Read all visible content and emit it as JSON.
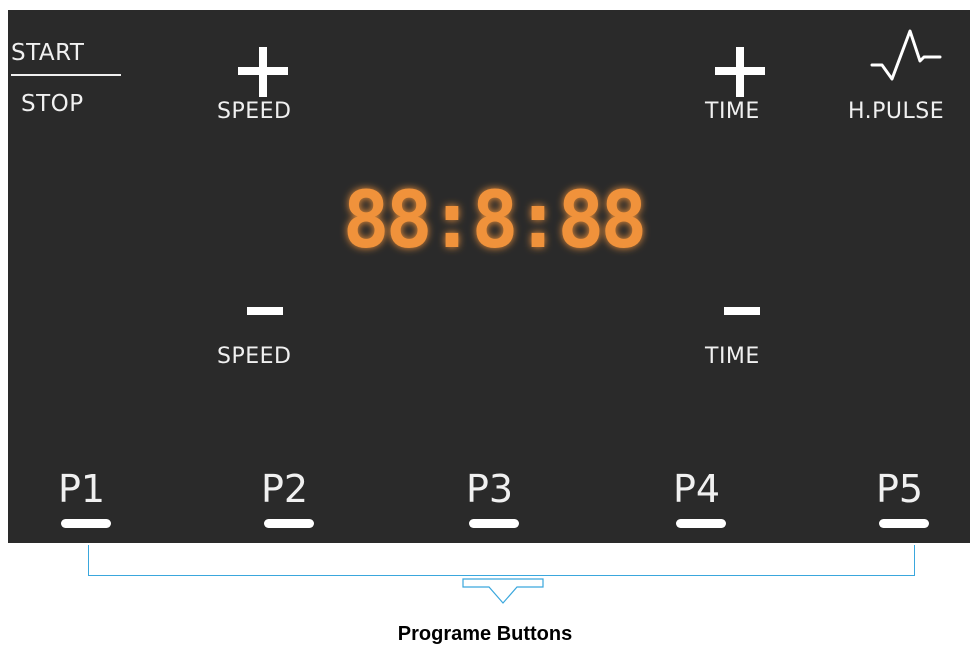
{
  "panel": {
    "start_label": "START",
    "stop_label": "STOP",
    "speed_plus_label": "SPEED",
    "speed_minus_label": "SPEED",
    "time_plus_label": "TIME",
    "time_minus_label": "TIME",
    "pulse_label": "H.PULSE",
    "display_value": "88:8:88",
    "display_color": "#f0923a",
    "programs": [
      "P1",
      "P2",
      "P3",
      "P4",
      "P5"
    ]
  },
  "annotation": {
    "caption": "Programe Buttons",
    "accent_color": "#3aa7dd"
  },
  "icons": {
    "plus": "plus-icon",
    "minus": "minus-icon",
    "pulse": "heartbeat-pulse-icon",
    "arrow": "down-arrow-icon"
  }
}
